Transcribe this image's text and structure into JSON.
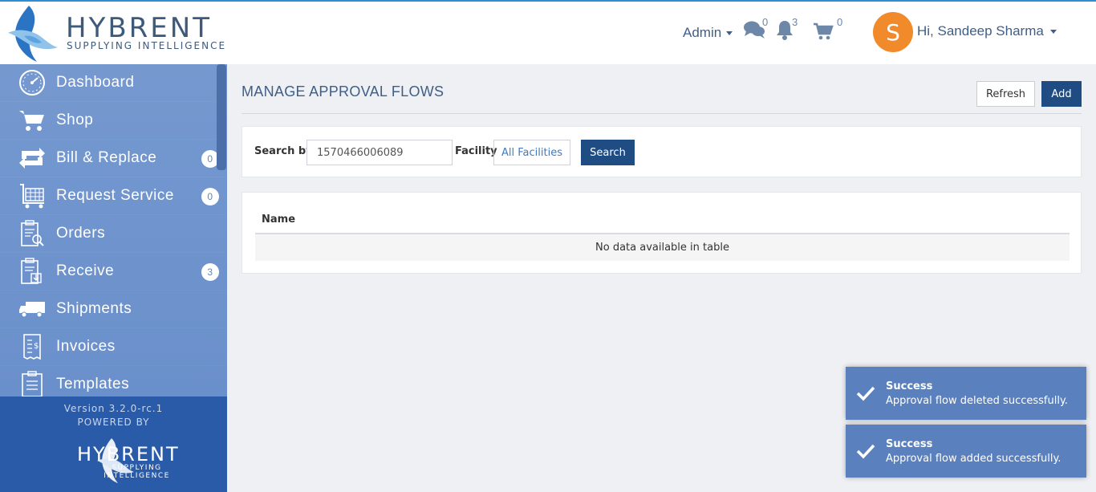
{
  "header": {
    "logo_word": "HYBRENT",
    "logo_tagline": "SUPPLYING INTELLIGENCE",
    "role_menu": "Admin",
    "messages_count": "0",
    "notifications_count": "3",
    "cart_count": "0",
    "avatar_letter": "S",
    "greeting": "Hi, Sandeep Sharma"
  },
  "sidebar": {
    "items": [
      {
        "label": "Dashboard",
        "icon": "dashboard-gauge-icon",
        "badge": ""
      },
      {
        "label": "Shop",
        "icon": "shopping-cart-icon",
        "badge": ""
      },
      {
        "label": "Bill & Replace",
        "icon": "swap-arrows-icon",
        "badge": "0"
      },
      {
        "label": "Request Service",
        "icon": "service-cart-icon",
        "badge": "0"
      },
      {
        "label": "Orders",
        "icon": "clipboard-search-icon",
        "badge": ""
      },
      {
        "label": "Receive",
        "icon": "clipboard-download-icon",
        "badge": "3"
      },
      {
        "label": "Shipments",
        "icon": "truck-icon",
        "badge": ""
      },
      {
        "label": "Invoices",
        "icon": "invoice-dollar-icon",
        "badge": ""
      },
      {
        "label": "Templates",
        "icon": "clipboard-list-icon",
        "badge": ""
      }
    ],
    "version": "Version 3.2.0-rc.1",
    "powered_by": "POWERED BY",
    "footer_logo_word": "HYBRENT",
    "footer_logo_tagline": "SUPPLYING INTELLIGENCE"
  },
  "main": {
    "title": "MANAGE APPROVAL FLOWS",
    "refresh_label": "Refresh",
    "add_label": "Add",
    "search_by_label": "Search by",
    "search_value": "1570466006089",
    "facility_label": "Facility",
    "facility_value": "All Facilities",
    "search_button": "Search",
    "table": {
      "columns": [
        "Name"
      ],
      "empty_message": "No data available in table"
    }
  },
  "toasts": [
    {
      "title": "Success",
      "message": "Approval flow deleted successfully."
    },
    {
      "title": "Success",
      "message": "Approval flow added successfully."
    }
  ],
  "colors": {
    "accent": "#1f4c82",
    "sidebar": "#6b91cb",
    "sidebar_footer": "#2a5ba8",
    "avatar": "#f08a2a",
    "toast": "#5b80be"
  }
}
